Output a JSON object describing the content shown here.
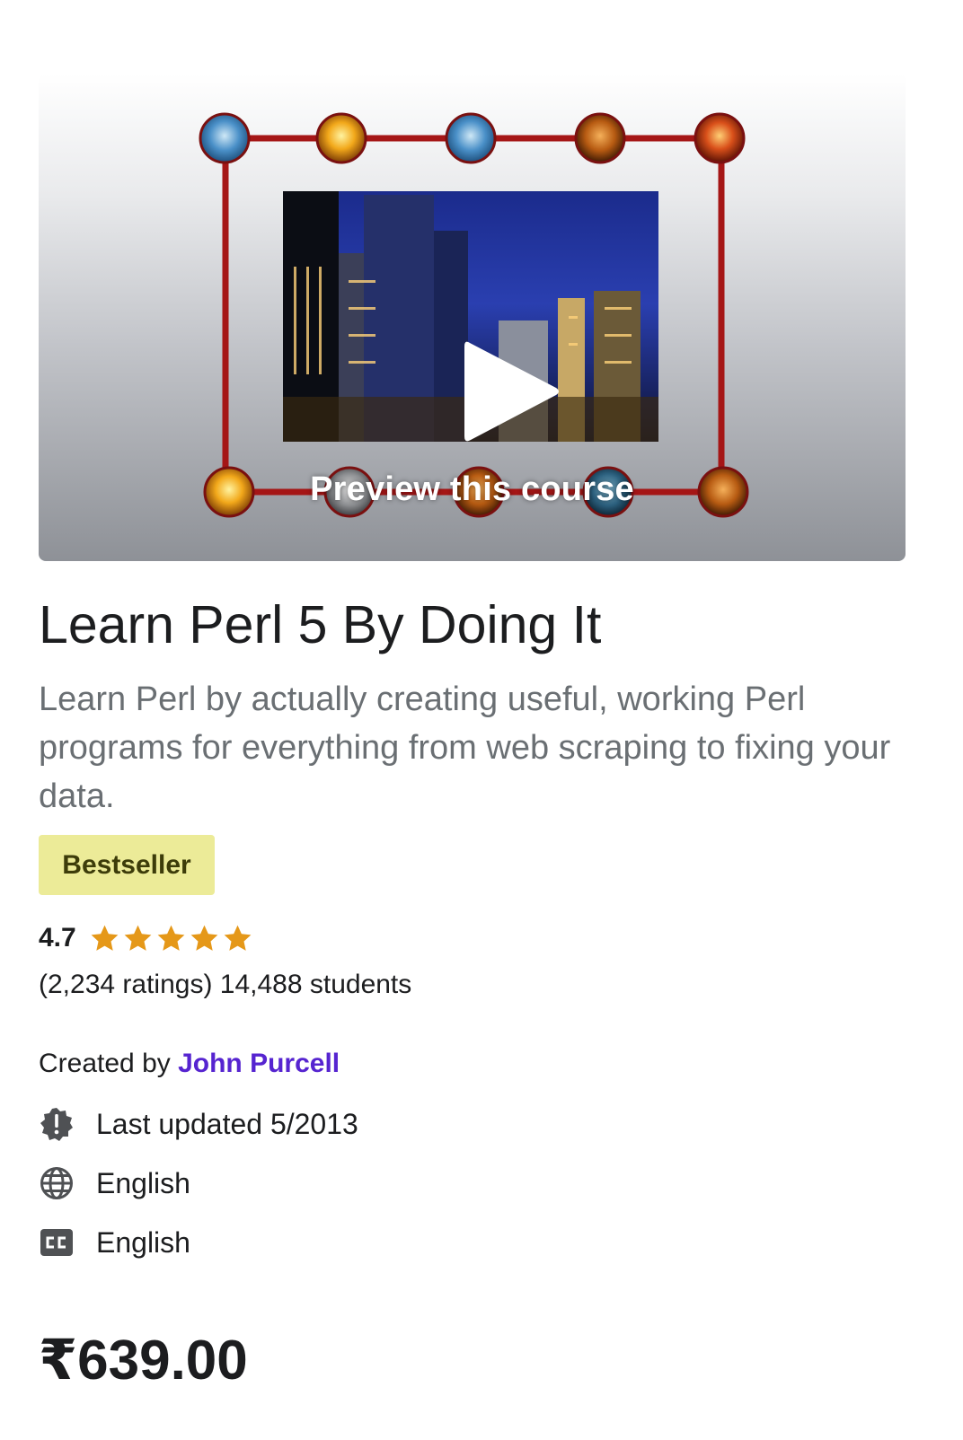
{
  "preview": {
    "label": "Preview this course",
    "play_icon": "play-icon",
    "frame_color": "#a51616"
  },
  "course": {
    "title": "Learn Perl 5 By Doing It",
    "subtitle": "Learn Perl by actually creating useful, working Perl programs for everything from web scraping to fixing your data.",
    "badge": "Bestseller",
    "rating_value": "4.7",
    "rating_stars": 5,
    "counts": "(2,234 ratings) 14,488 students",
    "created_by_label": "Created by",
    "instructor": "John Purcell",
    "last_updated": "Last updated 5/2013",
    "language": "English",
    "captions": "English",
    "price": "₹639.00"
  },
  "colors": {
    "instructor_link": "#5624d0",
    "badge_bg": "#eceb98",
    "star": "#e59819",
    "text": "#1c1d1f",
    "muted": "#6a6f73"
  },
  "icons": {
    "last_updated": "alert-badge-icon",
    "language": "globe-icon",
    "captions": "closed-captions-icon",
    "star": "star-icon"
  }
}
